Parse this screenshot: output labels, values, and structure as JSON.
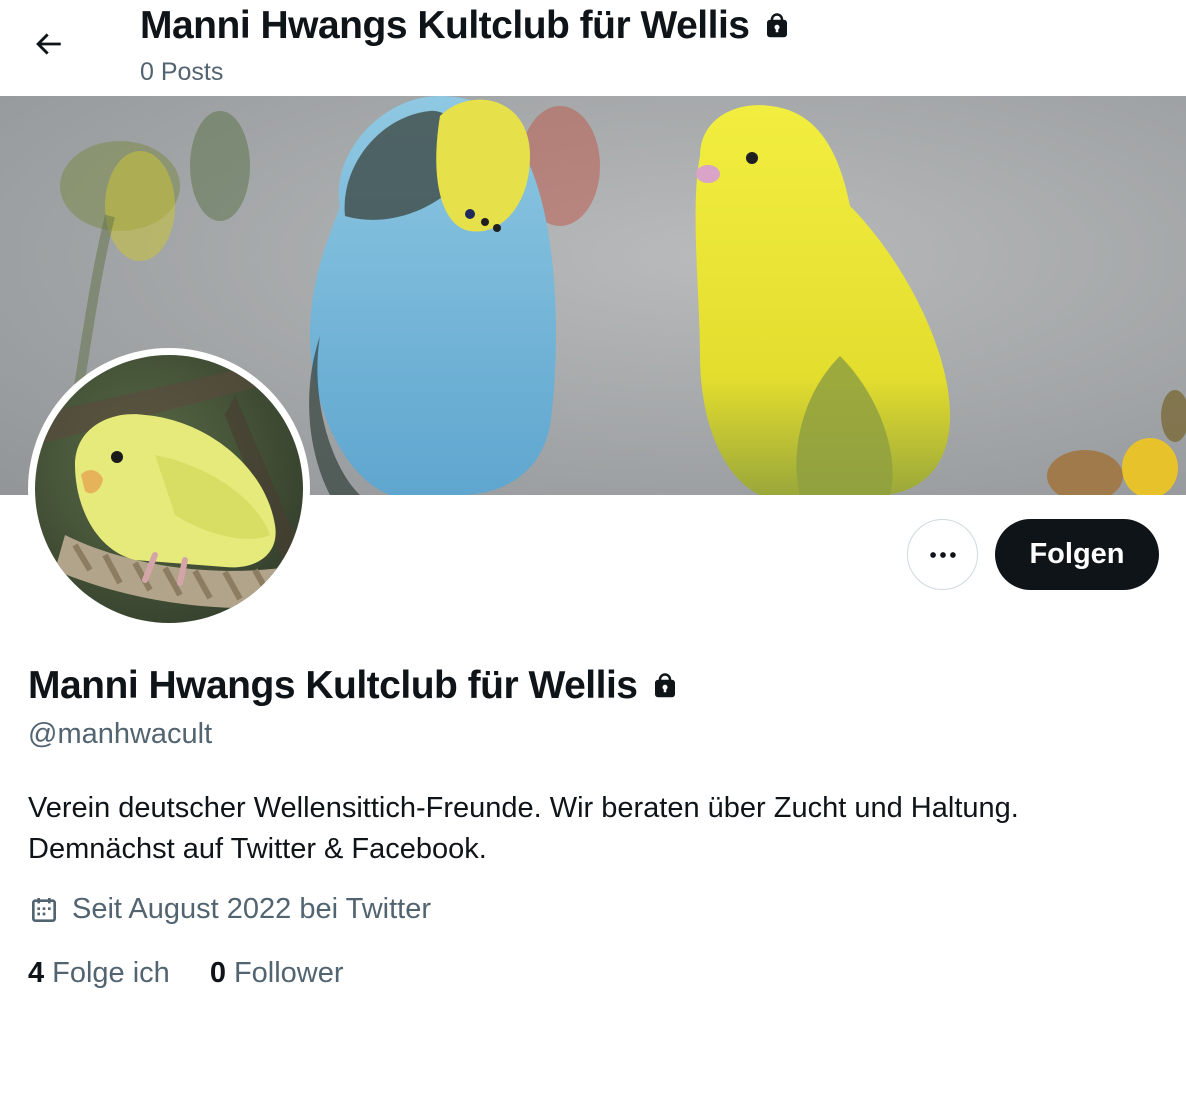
{
  "header": {
    "title": "Manni Hwangs Kultclub für Wellis",
    "post_count": "0 Posts"
  },
  "profile": {
    "display_name": "Manni Hwangs Kultclub für Wellis",
    "handle": "@manhwacult",
    "bio_line1": "Verein deutscher Wellensittich-Freunde. Wir beraten über Zucht und Haltung.",
    "bio_line2": "Demnächst auf Twitter & Facebook.",
    "joined": "Seit August 2022 bei Twitter",
    "following_count": "4",
    "following_label": "Folge ich",
    "followers_count": "0",
    "followers_label": "Follower"
  },
  "actions": {
    "follow_label": "Folgen"
  },
  "icons": {
    "back": "arrow-left-icon",
    "protected": "lock-icon",
    "more": "more-dots-icon",
    "calendar": "calendar-icon"
  },
  "colors": {
    "text_primary": "#0f1419",
    "text_secondary": "#536471",
    "button_dark": "#0f1419",
    "border": "#cfd9de"
  }
}
